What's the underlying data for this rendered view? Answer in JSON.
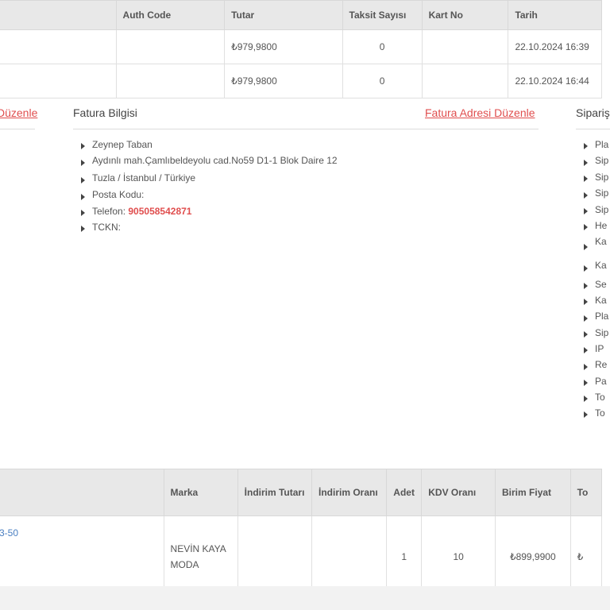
{
  "payments": {
    "headers": [
      "",
      "Auth Code",
      "Tutar",
      "Taksit Sayısı",
      "Kart No",
      "Tarih"
    ],
    "rows": [
      {
        "auth_code": "",
        "amount": "₺979,9800",
        "installments": "0",
        "card_no": "",
        "date": "22.10.2024 16:39"
      },
      {
        "auth_code": "",
        "amount": "₺979,9800",
        "installments": "0",
        "card_no": "",
        "date": "22.10.2024 16:44"
      }
    ]
  },
  "left_link": "Düzenle",
  "invoice": {
    "title": "Fatura Bilgisi",
    "edit_link": "Fatura Adresi Düzenle",
    "lines": [
      "Zeynep Taban",
      "Aydınlı mah.Çamlıbeldeyolu cad.No59 D1-1 Blok Daire 12",
      "Tuzla / İstanbul / Türkiye",
      "Posta Kodu:"
    ],
    "phone_label": "Telefon:",
    "phone_value": "905058542871",
    "tckn_label": "TCKN:"
  },
  "order": {
    "title": "Sipariş",
    "items": [
      "Pla",
      "Sip",
      "Sip",
      "Sip",
      "Sip",
      "He",
      "Ka",
      "Ka",
      "Se",
      "Ka",
      "Pla",
      "Sip",
      "IP",
      "Re",
      "Pa",
      "To",
      "To"
    ]
  },
  "products": {
    "headers": [
      "",
      "Marka",
      "İndirim Tutarı",
      "İndirim Oranı",
      "Adet",
      "KDV Oranı",
      "Birim Fiyat",
      "To"
    ],
    "row": {
      "product_code": "3-50",
      "brand_line1": "NEVİN KAYA",
      "brand_line2": "MODA",
      "discount_amount": "",
      "discount_rate": "",
      "quantity": "1",
      "vat_rate": "10",
      "unit_price": "₺899,9900",
      "total": "₺"
    }
  }
}
